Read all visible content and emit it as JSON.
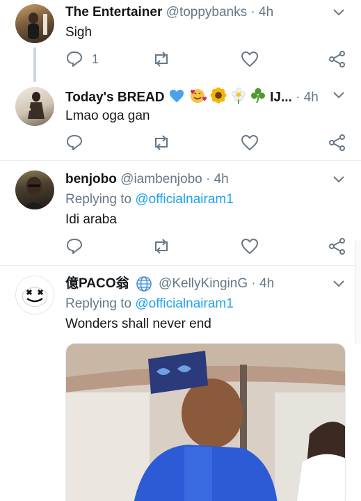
{
  "tweets": [
    {
      "name": "The Entertainer",
      "handle": "@toppybanks",
      "separator": "·",
      "time": "4h",
      "text": "Sigh",
      "reply_count": "1"
    },
    {
      "name": "Today's BREAD",
      "name_emojis": [
        "blue-heart",
        "smiling-face-with-hearts",
        "sunflower",
        "blossom",
        "shamrock"
      ],
      "handle_truncated": "IJ...",
      "separator": "·",
      "time": "4h",
      "text": "Lmao oga gan"
    },
    {
      "name": "benjobo",
      "handle": "@iambenjobo",
      "separator": "·",
      "time": "4h",
      "replying_prefix": "Replying to",
      "replying_to": "@officialnairam1",
      "text": "Idi araba"
    },
    {
      "name": "億PACO翁",
      "name_icon": "globe-icon",
      "handle": "@KellyKinginG",
      "separator": "·",
      "time": "4h",
      "replying_prefix": "Replying to",
      "replying_to": "@officialnairam1",
      "text": "Wonders shall never end",
      "has_image": true
    }
  ],
  "colors": {
    "text": "#14171a",
    "secondary": "#657786",
    "link": "#1da1f2",
    "divider": "#e6ecf0",
    "thread_line": "#ccd6dd",
    "heart_blue": "#4aa3e8"
  }
}
